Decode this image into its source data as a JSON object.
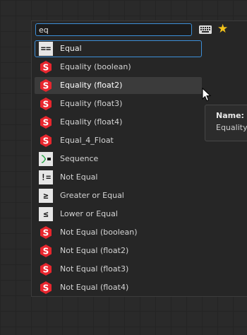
{
  "search": {
    "value": "eq",
    "keyboard_icon": "keyboard-icon",
    "favorite_icon": "star-icon",
    "favorite_glyph": "★"
  },
  "results": [
    {
      "label": "Equal",
      "icon": "==",
      "kind": "symbol"
    },
    {
      "label": "Equality (boolean)",
      "icon": "substance-icon",
      "kind": "substance"
    },
    {
      "label": "Equality (float2)",
      "icon": "substance-icon",
      "kind": "substance"
    },
    {
      "label": "Equality (float3)",
      "icon": "substance-icon",
      "kind": "substance"
    },
    {
      "label": "Equality (float4)",
      "icon": "substance-icon",
      "kind": "substance"
    },
    {
      "label": "Equal_4_Float",
      "icon": "substance-icon",
      "kind": "substance"
    },
    {
      "label": "Sequence",
      "icon": "sequence-icon",
      "kind": "sequence"
    },
    {
      "label": "Not Equal",
      "icon": "!=",
      "kind": "symbol"
    },
    {
      "label": "Greater or Equal",
      "icon": "≥",
      "kind": "symbol"
    },
    {
      "label": "Lower or Equal",
      "icon": "≤",
      "kind": "symbol"
    },
    {
      "label": "Not Equal (boolean)",
      "icon": "substance-icon",
      "kind": "substance"
    },
    {
      "label": "Not Equal (float2)",
      "icon": "substance-icon",
      "kind": "substance"
    },
    {
      "label": "Not Equal (float3)",
      "icon": "substance-icon",
      "kind": "substance"
    },
    {
      "label": "Not Equal (float4)",
      "icon": "substance-icon",
      "kind": "substance"
    }
  ],
  "tooltip": {
    "title": "Name:",
    "value": "Equality"
  },
  "colors": {
    "accent": "#3d8fd8",
    "substance_red": "#e8262e",
    "star": "#f3c31a",
    "hover_bg": "#3b3b3b"
  }
}
